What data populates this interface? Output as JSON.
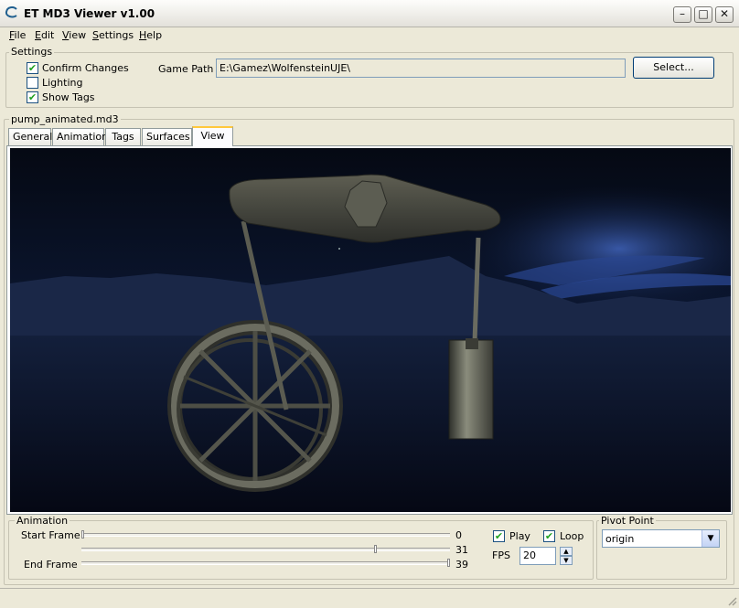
{
  "window": {
    "title": "ET MD3 Viewer v1.00",
    "min": "–",
    "max": "□",
    "close": "✕"
  },
  "menu": [
    {
      "key": "F",
      "rest": "ile"
    },
    {
      "key": "E",
      "rest": "dit"
    },
    {
      "key": "V",
      "rest": "iew"
    },
    {
      "key": "S",
      "rest": "ettings"
    },
    {
      "key": "H",
      "rest": "elp"
    }
  ],
  "settings": {
    "title": "Settings",
    "confirm_changes": {
      "label": "Confirm Changes",
      "checked": true
    },
    "lighting": {
      "label": "Lighting",
      "checked": false
    },
    "show_tags": {
      "label": "Show Tags",
      "checked": true
    },
    "game_path_label": "Game Path",
    "game_path_value": "E:\\Gamez\\WolfensteinUJE\\",
    "select_button": "Select..."
  },
  "file_group_title": "pump_animated.md3",
  "tabs": [
    "General",
    "Animation",
    "Tags",
    "Surfaces",
    "View"
  ],
  "active_tab": "View",
  "animation": {
    "title": "Animation",
    "start_frame_label": "Start Frame",
    "start_frame_value": "0",
    "current_frame_value": "31",
    "end_frame_label": "End Frame",
    "end_frame_value": "39",
    "play": {
      "label": "Play",
      "checked": true
    },
    "loop": {
      "label": "Loop",
      "checked": true
    },
    "fps_label": "FPS",
    "fps_value": "20"
  },
  "pivot": {
    "title": "Pivot Point",
    "value": "origin"
  },
  "icons": {
    "check": "✔",
    "dropdown": "▼",
    "spin_up": "▲",
    "spin_down": "▼"
  }
}
